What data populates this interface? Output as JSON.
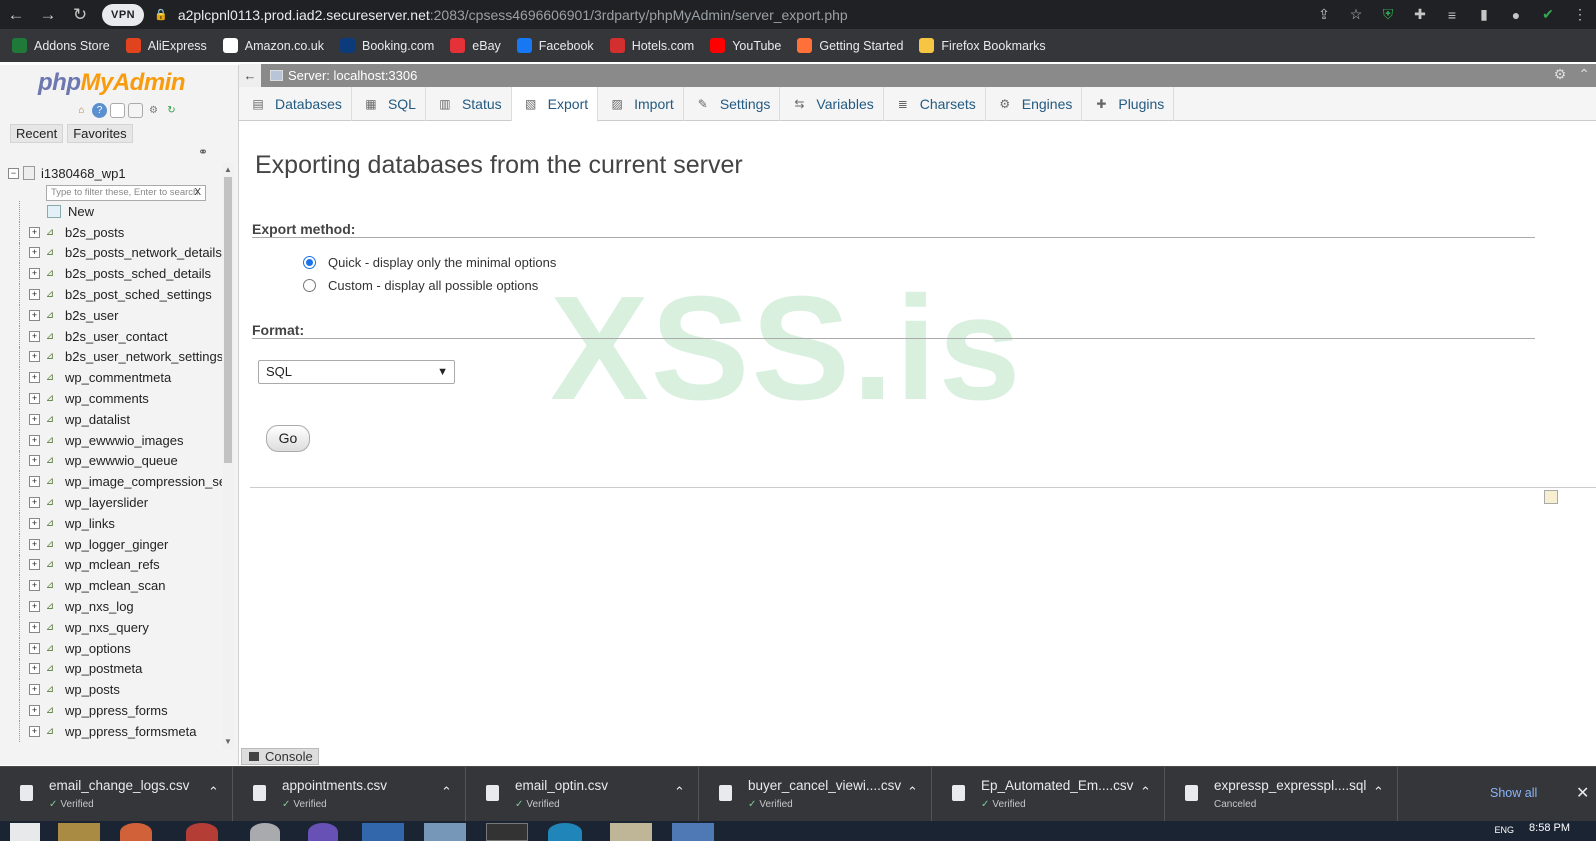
{
  "browser": {
    "vpn_label": "VPN",
    "url_host": "a2plcpnl0113.prod.iad2.secureserver.net",
    "url_path": ":2083/cpsess4696606901/3rdparty/phpMyAdmin/server_export.php"
  },
  "bookmarks": [
    {
      "label": "Addons Store",
      "color": "#1f7a3a"
    },
    {
      "label": "AliExpress",
      "color": "#e2431f"
    },
    {
      "label": "Amazon.co.uk",
      "color": "#ffffff"
    },
    {
      "label": "Booking.com",
      "color": "#0c3b7c"
    },
    {
      "label": "eBay",
      "color": "#e53238"
    },
    {
      "label": "Facebook",
      "color": "#1877f2"
    },
    {
      "label": "Hotels.com",
      "color": "#d32f2f"
    },
    {
      "label": "YouTube",
      "color": "#ff0000"
    },
    {
      "label": "Getting Started",
      "color": "#ff7139"
    },
    {
      "label": "Firefox Bookmarks",
      "color": "#f6c643"
    }
  ],
  "nav": {
    "logo_php": "php",
    "logo_myadmin": "MyAdmin",
    "recent": "Recent",
    "favorites": "Favorites",
    "db_name": "i1380468_wp1",
    "filter_placeholder": "Type to filter these, Enter to search",
    "filter_clear": "X",
    "new_label": "New",
    "tables": [
      "b2s_posts",
      "b2s_posts_network_details",
      "b2s_posts_sched_details",
      "b2s_post_sched_settings",
      "b2s_user",
      "b2s_user_contact",
      "b2s_user_network_settings",
      "wp_commentmeta",
      "wp_comments",
      "wp_datalist",
      "wp_ewwwio_images",
      "wp_ewwwio_queue",
      "wp_image_compression_settings",
      "wp_layerslider",
      "wp_links",
      "wp_logger_ginger",
      "wp_mclean_refs",
      "wp_mclean_scan",
      "wp_nxs_log",
      "wp_nxs_query",
      "wp_options",
      "wp_postmeta",
      "wp_posts",
      "wp_ppress_forms",
      "wp_ppress_formsmeta"
    ]
  },
  "server_bar": {
    "title": "Server: localhost:3306"
  },
  "tabs": [
    {
      "label": "Databases",
      "icon": "database-icon",
      "glyph": "▤"
    },
    {
      "label": "SQL",
      "icon": "sql-icon",
      "glyph": "▦"
    },
    {
      "label": "Status",
      "icon": "status-icon",
      "glyph": "▥"
    },
    {
      "label": "Export",
      "icon": "export-icon",
      "glyph": "▧",
      "active": true
    },
    {
      "label": "Import",
      "icon": "import-icon",
      "glyph": "▨"
    },
    {
      "label": "Settings",
      "icon": "wrench-icon",
      "glyph": "✎"
    },
    {
      "label": "Variables",
      "icon": "variables-icon",
      "glyph": "⇆"
    },
    {
      "label": "Charsets",
      "icon": "charsets-icon",
      "glyph": "≣"
    },
    {
      "label": "Engines",
      "icon": "engines-icon",
      "glyph": "⚙"
    },
    {
      "label": "Plugins",
      "icon": "puzzle-icon",
      "glyph": "✚"
    }
  ],
  "main": {
    "title": "Exporting databases from the current server",
    "export_method_label": "Export method:",
    "quick_option": "Quick - display only the minimal options",
    "custom_option": "Custom - display all possible options",
    "selected_method": "quick",
    "format_label": "Format:",
    "format_value": "SQL",
    "go_label": "Go",
    "watermark": "XSS.is"
  },
  "console_label": "Console",
  "downloads": [
    {
      "name": "email_change_logs.csv",
      "status": "Verified"
    },
    {
      "name": "appointments.csv",
      "status": "Verified"
    },
    {
      "name": "email_optin.csv",
      "status": "Verified"
    },
    {
      "name": "buyer_cancel_viewi....csv",
      "status": "Verified"
    },
    {
      "name": "Ep_Automated_Em....csv",
      "status": "Verified"
    },
    {
      "name": "expressp_expresspl....sql",
      "status": "Canceled"
    }
  ],
  "downloads_show_all": "Show all",
  "taskbar": {
    "time": "8:58 PM",
    "lang": "ENG"
  }
}
